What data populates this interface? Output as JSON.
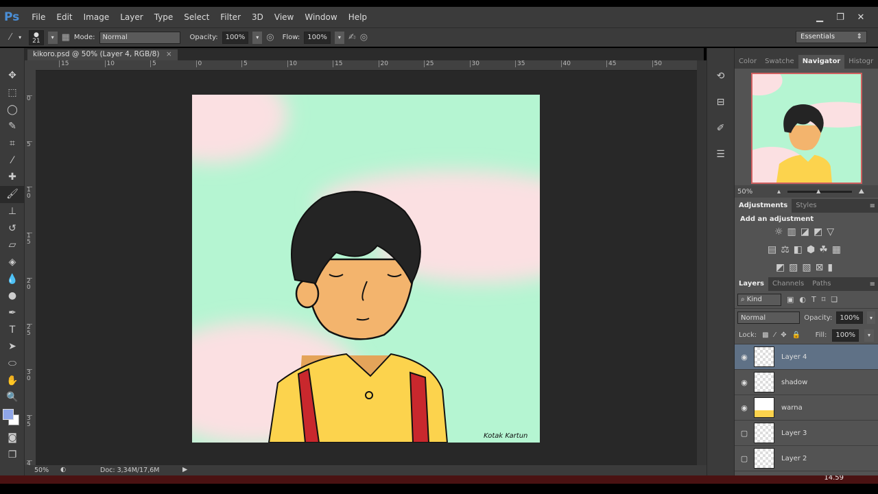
{
  "app": {
    "logo": "Ps"
  },
  "menu": [
    "File",
    "Edit",
    "Image",
    "Layer",
    "Type",
    "Select",
    "Filter",
    "3D",
    "View",
    "Window",
    "Help"
  ],
  "window_controls": [
    "minimize",
    "restore",
    "close"
  ],
  "options": {
    "brush_size": "21",
    "mode_label": "Mode:",
    "mode_value": "Normal",
    "opacity_label": "Opacity:",
    "opacity_value": "100%",
    "flow_label": "Flow:",
    "flow_value": "100%",
    "workspace": "Essentials"
  },
  "document": {
    "tab_title": "kikoro.psd @ 50% (Layer 4, RGB/8)",
    "close": "×",
    "signature": "Kotak Kartun"
  },
  "rulers": {
    "h": [
      "15",
      "10",
      "5",
      "0",
      "5",
      "10",
      "15",
      "20",
      "25",
      "30",
      "35",
      "40",
      "45",
      "50"
    ],
    "v": [
      "0",
      "5",
      "1 0",
      "1 5",
      "2 0",
      "2 5",
      "3 0",
      "3 5",
      "4"
    ]
  },
  "status": {
    "zoom": "50%",
    "doc": "Doc: 3,34M/17,6M"
  },
  "navigator": {
    "tabs": [
      "Color",
      "Swatche",
      "Navigator",
      "Histogr"
    ],
    "active": 2,
    "zoom": "50%"
  },
  "adjustments": {
    "tabs": [
      "Adjustments",
      "Styles"
    ],
    "title": "Add an adjustment"
  },
  "layers_panel": {
    "tabs": [
      "Layers",
      "Channels",
      "Paths"
    ],
    "filter": "Kind",
    "blend": "Normal",
    "opacity_label": "Opacity:",
    "opacity": "100%",
    "lock_label": "Lock:",
    "fill_label": "Fill:",
    "fill": "100%",
    "layers": [
      {
        "name": "Layer 4",
        "visible": true,
        "selected": true
      },
      {
        "name": "shadow",
        "visible": true
      },
      {
        "name": "warna",
        "visible": true
      },
      {
        "name": "Layer 3",
        "visible": false
      },
      {
        "name": "Layer 2",
        "visible": false
      }
    ]
  },
  "taskbar": {
    "clock": "14.59"
  },
  "colors": {
    "foreground": "#8fa6e8",
    "background": "#ffffff",
    "canvas_mint": "#b5f5d2",
    "canvas_pink": "#fbe0e2",
    "hair": "#242424",
    "skin": "#f3b46d",
    "shirt": "#fcd34d",
    "strap": "#c9282d"
  }
}
